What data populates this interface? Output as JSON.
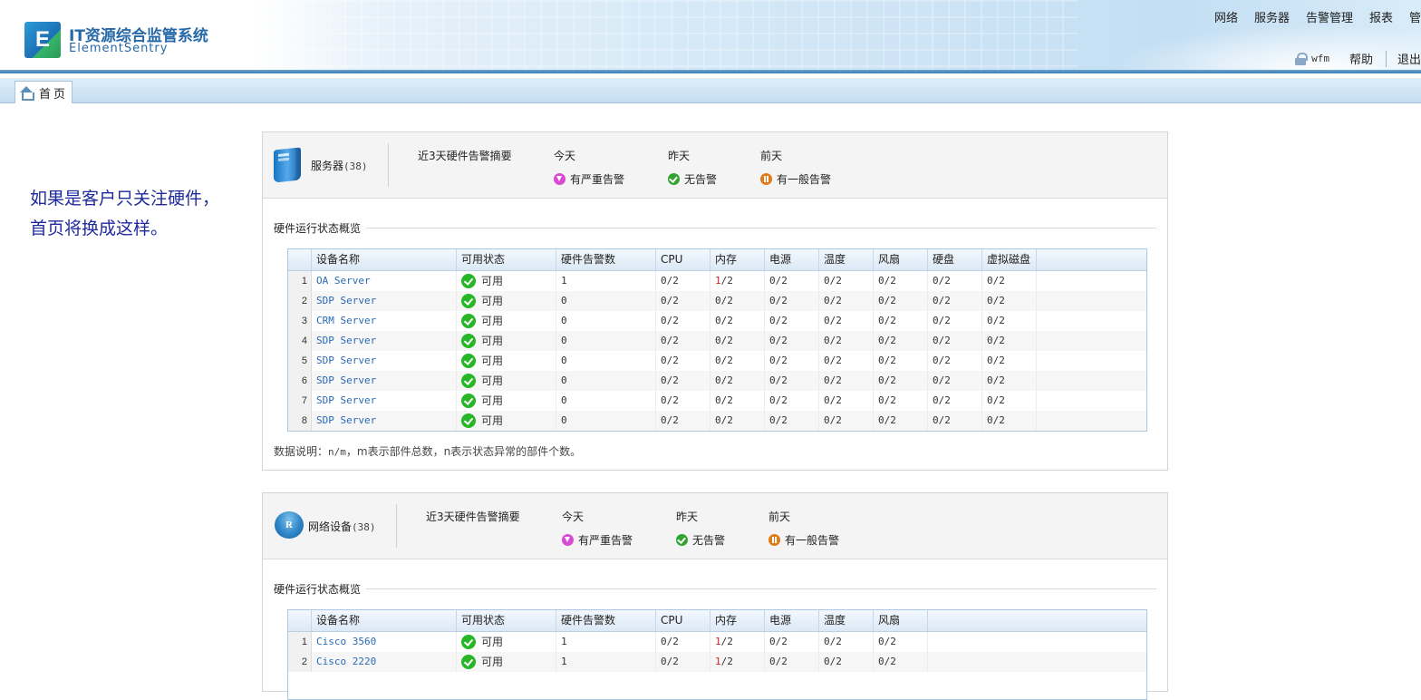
{
  "header": {
    "logo_letter": "E",
    "app_title": "IT资源综合监管系统",
    "app_subtitle": "ElementSentry",
    "nav": [
      "网络",
      "服务器",
      "告警管理",
      "报表",
      "管理"
    ],
    "user": "wfm",
    "help": "帮助",
    "logout": "退出"
  },
  "tabs": [
    {
      "label": "首页"
    }
  ],
  "note": {
    "line1": "如果是客户只关注硬件，",
    "line2": "首页将换成这样。"
  },
  "server_panel": {
    "title": "服务器",
    "count": "(38)",
    "summary_label": "近3天硬件告警摘要",
    "days": [
      {
        "label": "今天",
        "status": "有严重告警",
        "level": "severe"
      },
      {
        "label": "昨天",
        "status": "无告警",
        "level": "ok"
      },
      {
        "label": "前天",
        "status": "有一般告警",
        "level": "normal"
      }
    ],
    "section_title": "硬件运行状态概览",
    "columns": [
      "设备名称",
      "可用状态",
      "硬件告警数",
      "CPU",
      "内存",
      "电源",
      "温度",
      "风扇",
      "硬盘",
      "虚拟磁盘"
    ],
    "rows": [
      {
        "n": "1",
        "name": "OA Server",
        "avail": "可用",
        "alarms": "1",
        "cpu": "0/2",
        "mem": "1/2",
        "power": "0/2",
        "temp": "0/2",
        "fan": "0/2",
        "disk": "0/2",
        "vdisk": "0/2"
      },
      {
        "n": "2",
        "name": "SDP Server",
        "avail": "可用",
        "alarms": "0",
        "cpu": "0/2",
        "mem": "0/2",
        "power": "0/2",
        "temp": "0/2",
        "fan": "0/2",
        "disk": "0/2",
        "vdisk": "0/2"
      },
      {
        "n": "3",
        "name": "CRM Server",
        "avail": "可用",
        "alarms": "0",
        "cpu": "0/2",
        "mem": "0/2",
        "power": "0/2",
        "temp": "0/2",
        "fan": "0/2",
        "disk": "0/2",
        "vdisk": "0/2"
      },
      {
        "n": "4",
        "name": "SDP Server",
        "avail": "可用",
        "alarms": "0",
        "cpu": "0/2",
        "mem": "0/2",
        "power": "0/2",
        "temp": "0/2",
        "fan": "0/2",
        "disk": "0/2",
        "vdisk": "0/2"
      },
      {
        "n": "5",
        "name": "SDP Server",
        "avail": "可用",
        "alarms": "0",
        "cpu": "0/2",
        "mem": "0/2",
        "power": "0/2",
        "temp": "0/2",
        "fan": "0/2",
        "disk": "0/2",
        "vdisk": "0/2"
      },
      {
        "n": "6",
        "name": "SDP Server",
        "avail": "可用",
        "alarms": "0",
        "cpu": "0/2",
        "mem": "0/2",
        "power": "0/2",
        "temp": "0/2",
        "fan": "0/2",
        "disk": "0/2",
        "vdisk": "0/2"
      },
      {
        "n": "7",
        "name": "SDP Server",
        "avail": "可用",
        "alarms": "0",
        "cpu": "0/2",
        "mem": "0/2",
        "power": "0/2",
        "temp": "0/2",
        "fan": "0/2",
        "disk": "0/2",
        "vdisk": "0/2"
      },
      {
        "n": "8",
        "name": "SDP Server",
        "avail": "可用",
        "alarms": "0",
        "cpu": "0/2",
        "mem": "0/2",
        "power": "0/2",
        "temp": "0/2",
        "fan": "0/2",
        "disk": "0/2",
        "vdisk": "0/2"
      }
    ],
    "data_note_prefix": "数据说明：",
    "data_note_nm": "n/m",
    "data_note_rest": "，m表示部件总数，n表示状态异常的部件个数。"
  },
  "network_panel": {
    "title": "网络设备",
    "count": "(38)",
    "icon_letter": "R",
    "summary_label": "近3天硬件告警摘要",
    "days": [
      {
        "label": "今天",
        "status": "有严重告警",
        "level": "severe"
      },
      {
        "label": "昨天",
        "status": "无告警",
        "level": "ok"
      },
      {
        "label": "前天",
        "status": "有一般告警",
        "level": "normal"
      }
    ],
    "section_title": "硬件运行状态概览",
    "columns": [
      "设备名称",
      "可用状态",
      "硬件告警数",
      "CPU",
      "内存",
      "电源",
      "温度",
      "风扇"
    ],
    "rows": [
      {
        "n": "1",
        "name": "Cisco 3560",
        "avail": "可用",
        "alarms": "1",
        "cpu": "0/2",
        "mem": "1/2",
        "power": "0/2",
        "temp": "0/2",
        "fan": "0/2"
      },
      {
        "n": "2",
        "name": "Cisco 2220",
        "avail": "可用",
        "alarms": "1",
        "cpu": "0/2",
        "mem": "1/2",
        "power": "0/2",
        "temp": "0/2",
        "fan": "0/2"
      }
    ]
  }
}
